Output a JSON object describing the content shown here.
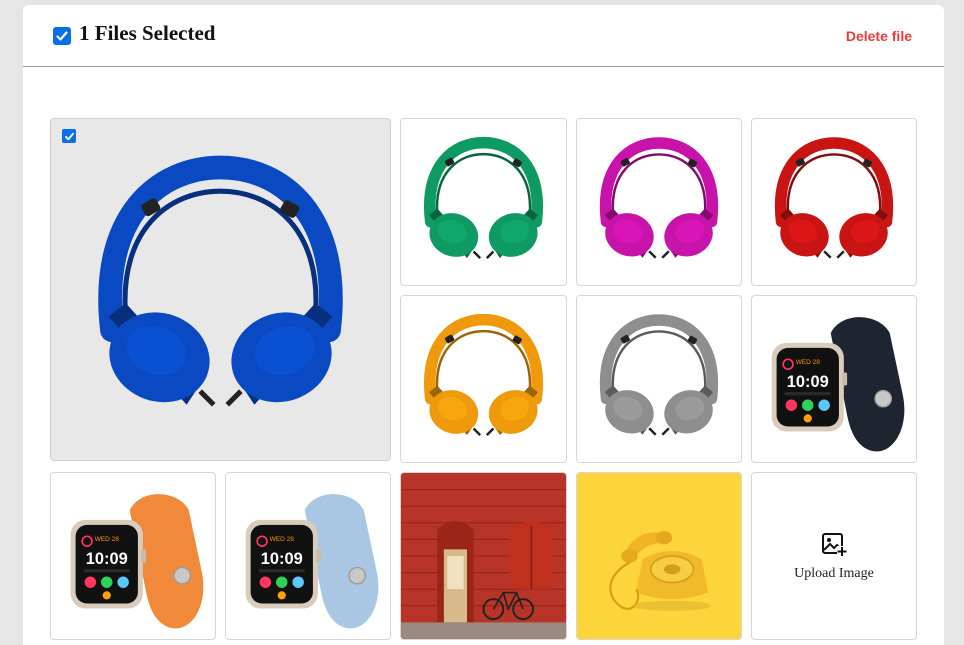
{
  "header": {
    "selected_label": "1 Files Selected",
    "delete_label": "Delete file",
    "all_checked": true
  },
  "gallery": {
    "items": [
      {
        "kind": "headphones",
        "color": "#0a49c2",
        "selected": true
      },
      {
        "kind": "headphones",
        "color": "#0f9a63",
        "selected": false
      },
      {
        "kind": "headphones",
        "color": "#c713a9",
        "selected": false
      },
      {
        "kind": "headphones",
        "color": "#c91414",
        "selected": false
      },
      {
        "kind": "headphones",
        "color": "#ee9a0c",
        "selected": false
      },
      {
        "kind": "headphones",
        "color": "#8e8e8e",
        "selected": false
      },
      {
        "kind": "watch",
        "band_color": "#1f2530",
        "selected": false
      },
      {
        "kind": "watch",
        "band_color": "#f1893a",
        "selected": false
      },
      {
        "kind": "watch",
        "band_color": "#a9c6e3",
        "selected": false
      },
      {
        "kind": "building-door",
        "selected": false
      },
      {
        "kind": "telephone",
        "selected": false
      }
    ],
    "upload_label": "Upload Image"
  },
  "watch_face": {
    "time": "10:09",
    "day": "WED 28"
  }
}
